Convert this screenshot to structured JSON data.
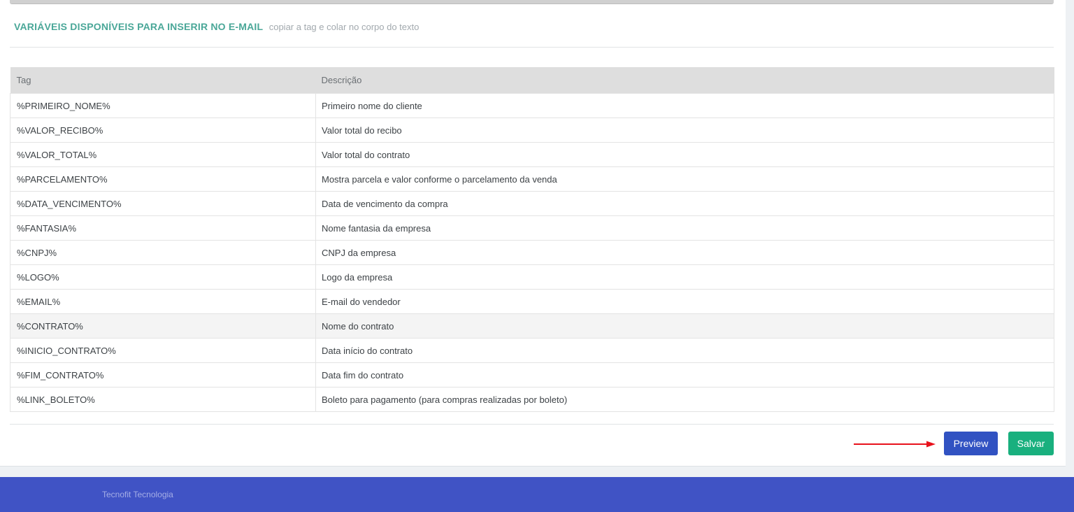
{
  "section": {
    "title": "VARIÁVEIS DISPONÍVEIS PARA INSERIR NO E-MAIL",
    "subtitle": "copiar a tag e colar no corpo do texto"
  },
  "table": {
    "headers": [
      "Tag",
      "Descrição"
    ],
    "rows": [
      {
        "tag": "%PRIMEIRO_NOME%",
        "description": "Primeiro nome do cliente"
      },
      {
        "tag": "%VALOR_RECIBO%",
        "description": "Valor total do recibo"
      },
      {
        "tag": "%VALOR_TOTAL%",
        "description": "Valor total do contrato"
      },
      {
        "tag": "%PARCELAMENTO%",
        "description": "Mostra parcela e valor conforme o parcelamento da venda"
      },
      {
        "tag": "%DATA_VENCIMENTO%",
        "description": "Data de vencimento da compra"
      },
      {
        "tag": "%FANTASIA%",
        "description": "Nome fantasia da empresa"
      },
      {
        "tag": "%CNPJ%",
        "description": "CNPJ da empresa"
      },
      {
        "tag": "%LOGO%",
        "description": "Logo da empresa"
      },
      {
        "tag": "%EMAIL%",
        "description": "E-mail do vendedor"
      },
      {
        "tag": "%CONTRATO%",
        "description": "Nome do contrato"
      },
      {
        "tag": "%INICIO_CONTRATO%",
        "description": "Data início do contrato"
      },
      {
        "tag": "%FIM_CONTRATO%",
        "description": "Data fim do contrato"
      },
      {
        "tag": "%LINK_BOLETO%",
        "description": "Boleto para pagamento (para compras realizadas por boleto)"
      }
    ]
  },
  "buttons": {
    "preview_label": "Preview",
    "save_label": "Salvar"
  },
  "footer": {
    "text": "Tecnofit Tecnologia"
  },
  "colors": {
    "title_accent": "#4aa798",
    "preview_button": "#3152c2",
    "save_button": "#19b07e",
    "footer_background": "#4053c5",
    "annotation_arrow": "#e8111b"
  }
}
